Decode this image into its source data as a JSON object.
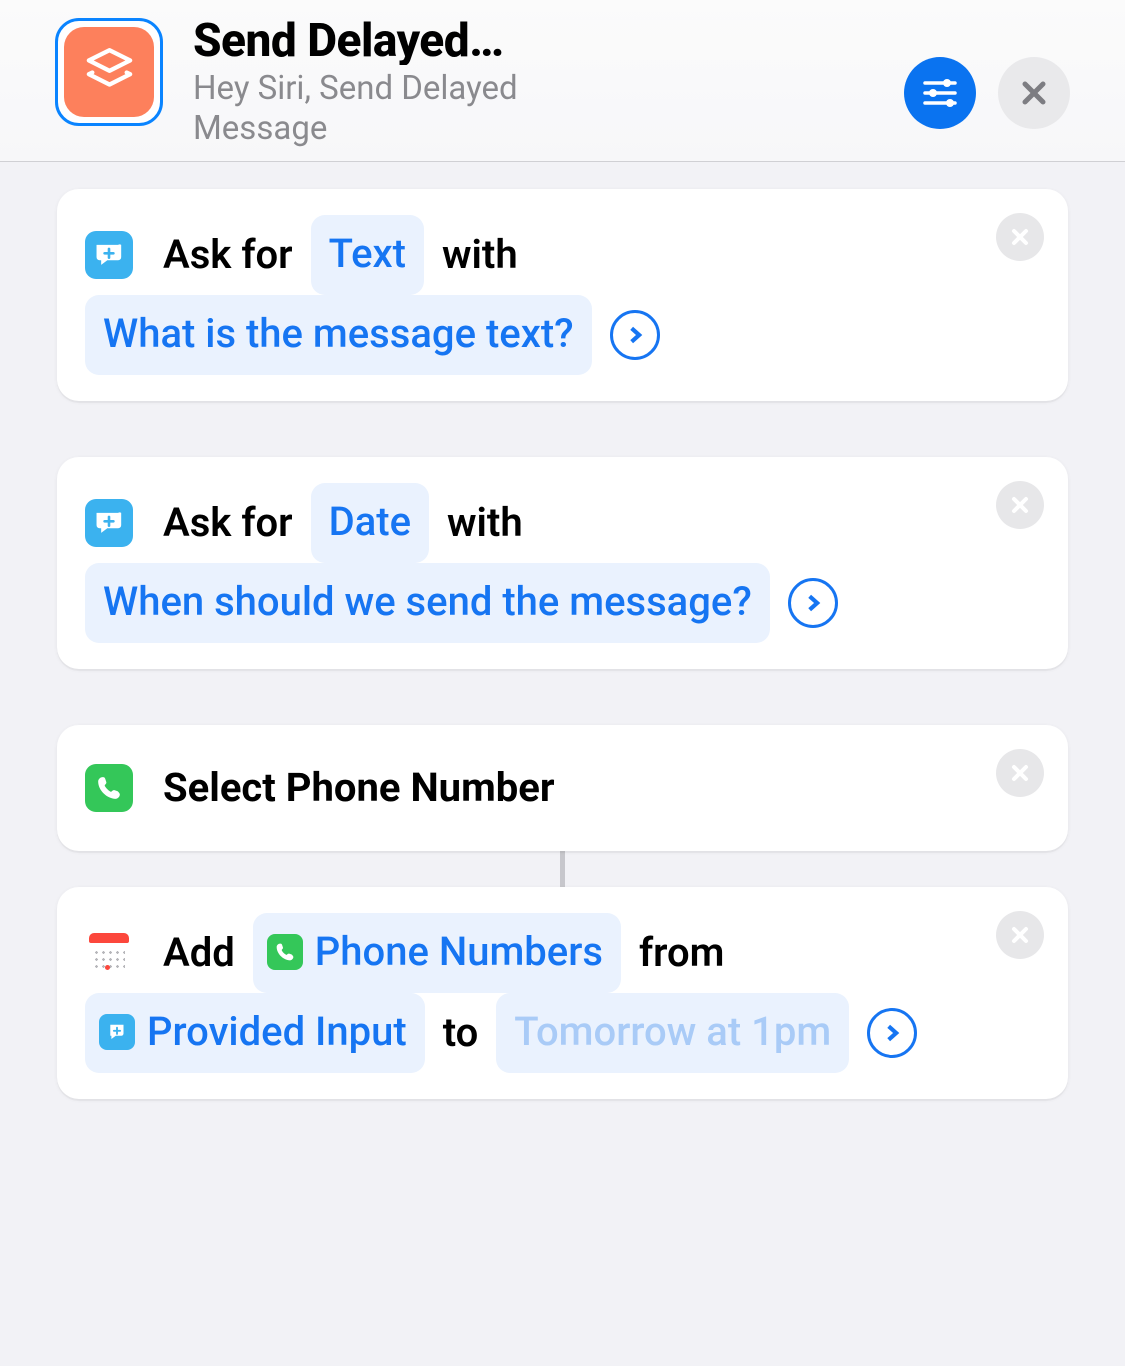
{
  "header": {
    "title": "Send Delayed…",
    "subtitle": "Hey Siri, Send Delayed Message"
  },
  "actions": {
    "a1": {
      "verb": "Ask for",
      "param_type": "Text",
      "with": "with",
      "prompt": "What is the message text?"
    },
    "a2": {
      "verb": "Ask for",
      "param_type": "Date",
      "with": "with",
      "prompt": "When should we send the message?"
    },
    "a3": {
      "label": "Select Phone Number"
    },
    "a4": {
      "verb": "Add",
      "token1": "Phone Numbers",
      "from": "from",
      "token2": "Provided Input",
      "to": "to",
      "placeholder": "Tomorrow at 1pm"
    }
  }
}
